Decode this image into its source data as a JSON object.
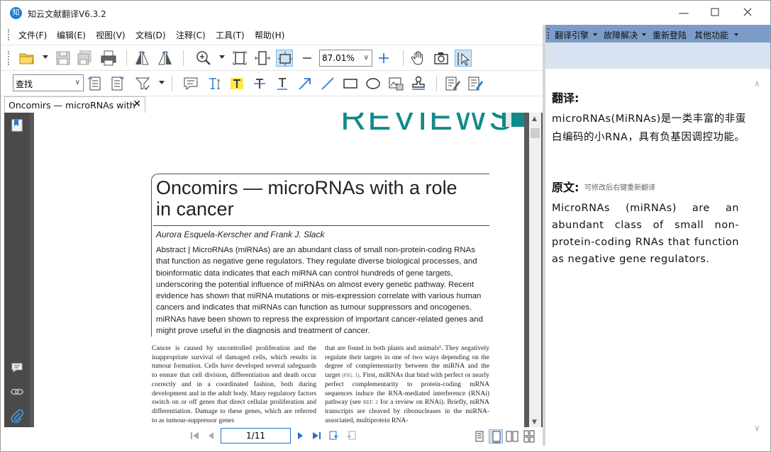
{
  "app": {
    "logo_text": "知",
    "title": "知云文献翻译V6.3.2"
  },
  "menu": [
    "文件(F)",
    "编辑(E)",
    "视图(V)",
    "文档(D)",
    "注释(C)",
    "工具(T)",
    "帮助(H)"
  ],
  "toolbar": {
    "zoom_value": "87.01%",
    "find_value": "查找"
  },
  "tab": {
    "label": "Oncomirs — microRNAs with",
    "close": "✕"
  },
  "document": {
    "header_text": "REVIEWS",
    "title": "Oncomirs — microRNAs with a role in cancer",
    "authors": "Aurora Esquela-Kerscher and Frank J. Slack",
    "abstract": "Abstract | MicroRNAs (miRNAs) are an abundant class of small non-protein-coding RNAs that function as negative gene regulators. They regulate diverse biological processes, and bioinformatic data indicates that each miRNA can control hundreds of gene targets, underscoring the potential influence of miRNAs on almost every genetic pathway. Recent evidence has shown that miRNA mutations or mis-expression correlate with various human cancers and indicates that miRNAs can function as tumour suppressors and oncogenes. miRNAs have been shown to repress the expression of important cancer-related genes and might prove useful in the diagnosis and treatment of cancer.",
    "col1": "Cancer is caused by uncontrolled proliferation and the inappropriate survival of damaged cells, which results in tumour formation. Cells have developed several safeguards to ensure that cell division, differentiation and death occur correctly and in a coordinated fashion, both during development and in the adult body. Many regulatory factors switch on or off genes that direct cellular proliferation and differentiation. Damage to these genes, which are referred to as tumour-suppressor genes",
    "col2_part1": "that are found in both plants and animals¹. They negatively regulate their targets in one of two ways depending on the degree of complementarity between the miRNA and the target ",
    "col2_ref1": "(FIG. 1)",
    "col2_part2": ". First, miRNAs that bind with perfect or nearly perfect complementarity to protein-coding mRNA sequences induce the RNA-mediated interference (RNAi) pathway (see ",
    "col2_ref2": "REF. 2",
    "col2_part3": " for a review on RNAi). Briefly, mRNA transcripts are cleaved by ribonucleases in the miRNA-associated, multiprotein RNA-"
  },
  "pager": {
    "page_display": "1/11"
  },
  "right_panel": {
    "menu": [
      "翻译引擎",
      "故障解决",
      "重新登陆",
      "其他功能"
    ],
    "translation_heading": "翻译:",
    "translation_text": "microRNAs(MiRNAs)是一类丰富的非蛋白编码的小RNA，具有负基因调控功能。",
    "original_heading": "原文:",
    "original_note": "可修改后右键重新翻译",
    "original_text": "MicroRNAs (miRNAs) are an abundant class of small non-protein-coding RNAs that function as negative gene regulators."
  },
  "colors": {
    "accent_teal": "#118a8a",
    "right_header": "#7a9cc7",
    "right_sub": "#d9e2f1",
    "doc_bg": "#595959"
  }
}
